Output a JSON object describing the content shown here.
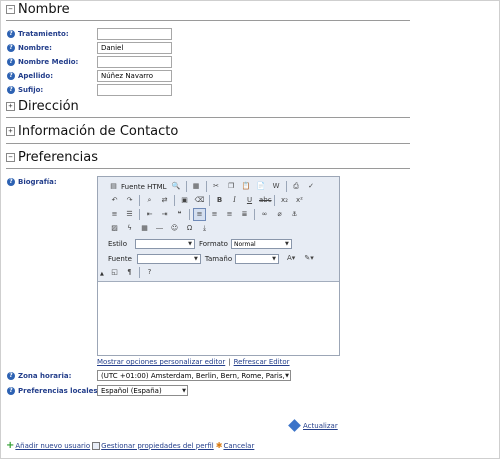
{
  "sections": {
    "nombre": {
      "toggle": "⊟",
      "title": "Nombre"
    },
    "direccion": {
      "toggle": "⊞",
      "title": "Dirección"
    },
    "contacto": {
      "toggle": "⊞",
      "title": "Información de Contacto"
    },
    "preferencias": {
      "toggle": "⊟",
      "title": "Preferencias"
    }
  },
  "fields": {
    "tratamiento": {
      "label": "Tratamiento:",
      "value": ""
    },
    "nombre": {
      "label": "Nombre:",
      "value": "Daniel"
    },
    "nombre_medio": {
      "label": "Nombre Medio:",
      "value": ""
    },
    "apellido": {
      "label": "Apellido:",
      "value": "Núñez Navarro"
    },
    "sufijo": {
      "label": "Sufijo:",
      "value": ""
    }
  },
  "biografia": {
    "label": "Biografía:",
    "toolbar": {
      "fuente_html": "Fuente HTML",
      "estilo_label": "Estilo",
      "estilo_value": "",
      "formato_label": "Formato",
      "formato_value": "Normal",
      "fuente_label": "Fuente",
      "fuente_value": "",
      "tamano_label": "Tamaño",
      "tamano_value": ""
    },
    "links": {
      "personalizar": "Mostrar opciones personalizar editor",
      "sep": "|",
      "refrescar": "Refrescar Editor"
    }
  },
  "zona_horaria": {
    "label": "Zona horaria:",
    "value": "(UTC +01:00) Amsterdam, Berlin, Bern, Rome, Paris,"
  },
  "preferencias_locales": {
    "label": "Preferencias locales:",
    "value": "Español (España)"
  },
  "actions": {
    "actualizar": "Actualizar",
    "nuevo_usuario": "Añadir nuevo usuario",
    "gestionar": "Gestionar propiedades del perfil",
    "cancelar": "Cancelar"
  }
}
